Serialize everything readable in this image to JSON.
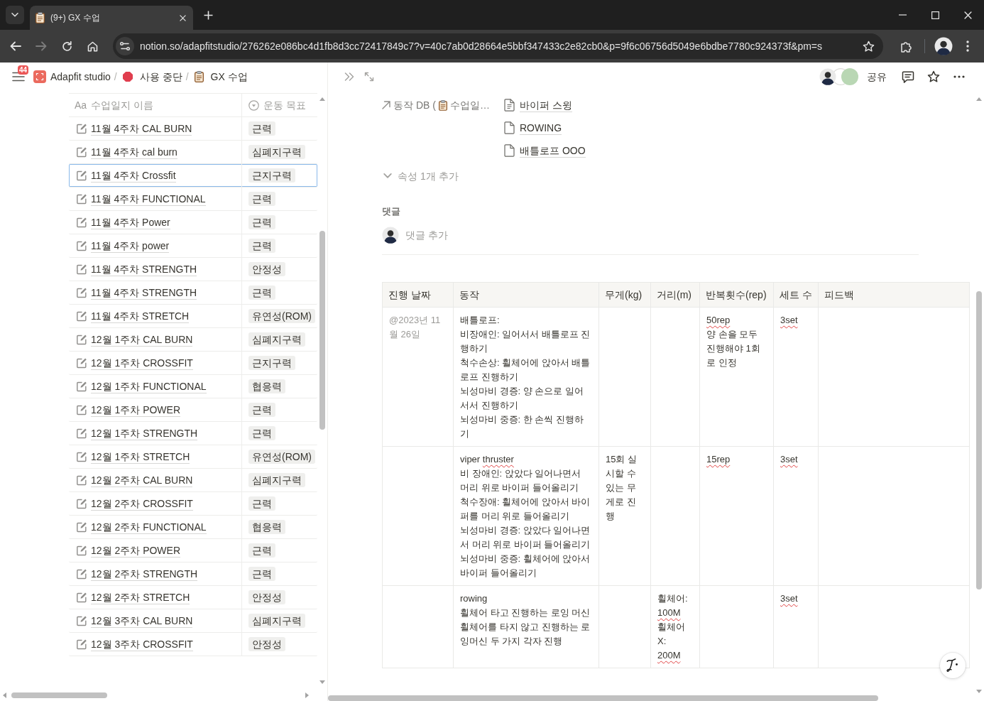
{
  "browser": {
    "tab": {
      "title": "(9+) GX 수업"
    },
    "nav_buttons": [
      {
        "kind": "back",
        "disabled": false
      },
      {
        "kind": "forward",
        "disabled": true
      },
      {
        "kind": "reload",
        "disabled": false
      },
      {
        "kind": "home",
        "disabled": false
      }
    ],
    "url": "notion.so/adapfitstudio/276262e086bc4d1fb8d3cc72417849c7?v=40c7ab0d28664e5bbf347433c2e82cb0&p=9f6c06756d5049e6bdbe7780c924373f&pm=s"
  },
  "breadcrumb": {
    "notification_count": "44",
    "items": [
      {
        "kind": "workspace",
        "label": "Adapfit studio",
        "separator": "/"
      },
      {
        "kind": "stop",
        "label": "사용 중단",
        "separator": "/"
      },
      {
        "kind": "clipboard",
        "label": "GX 수업"
      }
    ]
  },
  "list_table": {
    "columns": [
      {
        "kind": "title",
        "type_glyph": "Aa",
        "label": "수업일지 이름"
      },
      {
        "kind": "select",
        "label": "운동 목표"
      }
    ],
    "rows": [
      {
        "name": "11월 4주차 CAL BURN",
        "goal": "근력",
        "selected": false
      },
      {
        "name": "11월 4주차 cal burn",
        "goal": "심폐지구력",
        "selected": false
      },
      {
        "name": "11월 4주차 Crossfit",
        "goal": "근지구력",
        "selected": true
      },
      {
        "name": "11월 4주차 FUNCTIONAL",
        "goal": "근력",
        "selected": false
      },
      {
        "name": "11월 4주차 Power",
        "goal": "근력",
        "selected": false
      },
      {
        "name": "11월 4주차 power",
        "goal": "근력",
        "selected": false
      },
      {
        "name": "11월 4주차 STRENGTH",
        "goal": "안정성",
        "selected": false
      },
      {
        "name": "11월 4주차 STRENGTH",
        "goal": "근력",
        "selected": false
      },
      {
        "name": "11월 4주차 STRETCH",
        "goal": "유연성(ROM)",
        "selected": false
      },
      {
        "name": "12월 1주차 CAL BURN",
        "goal": "심폐지구력",
        "selected": false
      },
      {
        "name": "12월 1주차 CROSSFIT",
        "goal": "근지구력",
        "selected": false
      },
      {
        "name": "12월 1주차 FUNCTIONAL",
        "goal": "협응력",
        "selected": false
      },
      {
        "name": "12월 1주차 POWER",
        "goal": "근력",
        "selected": false
      },
      {
        "name": "12월 1주차 STRENGTH",
        "goal": "근력",
        "selected": false
      },
      {
        "name": "12월 1주차 STRETCH",
        "goal": "유연성(ROM)",
        "selected": false
      },
      {
        "name": "12월 2주차 CAL BURN",
        "goal": "심폐지구력",
        "selected": false
      },
      {
        "name": "12월 2주차 CROSSFIT",
        "goal": "근력",
        "selected": false
      },
      {
        "name": "12월 2주차 FUNCTIONAL",
        "goal": "협응력",
        "selected": false
      },
      {
        "name": "12월 2주차 POWER",
        "goal": "근력",
        "selected": false
      },
      {
        "name": "12월 2주차 STRENGTH",
        "goal": "근력",
        "selected": false
      },
      {
        "name": "12월 2주차 STRETCH",
        "goal": "안정성",
        "selected": false
      },
      {
        "name": "12월 3주차 CAL BURN",
        "goal": "심폐지구력",
        "selected": false
      },
      {
        "name": "12월 3주차 CROSSFIT",
        "goal": "안정성",
        "selected": false
      }
    ]
  },
  "topbar": {
    "avatars": [
      {
        "kind": "photo"
      },
      {
        "kind": "plain"
      },
      {
        "kind": "plain",
        "color": "#b9d7b4"
      }
    ],
    "share": "공유"
  },
  "properties": [
    {
      "name": "동작 DB (",
      "name_rest": "수업일…",
      "values": [
        {
          "kind": "doc",
          "title": "바이퍼 스윙"
        },
        {
          "kind": "blank",
          "title": "ROWING"
        },
        {
          "kind": "blank",
          "title": "배틀로프 OOO"
        }
      ]
    }
  ],
  "more_properties": {
    "label": "속성 1개 추가"
  },
  "comments": {
    "heading": "댓글",
    "placeholder": "댓글 추가"
  },
  "detail_table": {
    "columns": [
      {
        "label": "진행 날짜",
        "kind": "date"
      },
      {
        "label": "동작",
        "kind": "text"
      },
      {
        "label": "무게(kg)",
        "kind": "text"
      },
      {
        "label": "거리(m)",
        "kind": "text"
      },
      {
        "label": "반복횟수(rep)",
        "kind": "text"
      },
      {
        "label": "세트 수",
        "kind": "text"
      },
      {
        "label": "피드백",
        "kind": "text"
      }
    ],
    "rows": [
      {
        "cells": [
          {
            "lines": [
              [
                {
                  "text": "@2023년 11월 26일",
                  "misspelled": false
                }
              ]
            ]
          },
          {
            "lines": [
              [
                {
                  "text": "배틀로프:",
                  "misspelled": false
                }
              ],
              [
                {
                  "text": "비장애인: 일어서서 배틀로프 진행하기",
                  "misspelled": false
                }
              ],
              [
                {
                  "text": "척수손상: 휠체어에 앉아서 배틀로프 진행하기",
                  "misspelled": false
                }
              ],
              [
                {
                  "text": "뇌성마비 경증: 양 손으로 일어서서 진행하기",
                  "misspelled": false
                }
              ],
              [
                {
                  "text": "뇌성마비 중증: 한 손씩 진행하기",
                  "misspelled": false
                }
              ]
            ]
          },
          null,
          null,
          {
            "lines": [
              [
                {
                  "text": "50rep",
                  "misspelled": true
                }
              ],
              [
                {
                  "text": "양 손을 모두 진행해야 1회로 인정",
                  "misspelled": false
                }
              ]
            ]
          },
          {
            "lines": [
              [
                {
                  "text": "3set",
                  "misspelled": true
                }
              ]
            ]
          },
          null
        ]
      },
      {
        "cells": [
          null,
          {
            "lines": [
              [
                {
                  "text": "viper",
                  "misspelled": false
                },
                {
                  "text": "thruster",
                  "misspelled": true
                }
              ],
              [
                {
                  "text": "비 장애인: 앉았다 일어나면서 머리 위로 바이퍼 들어올리기",
                  "misspelled": false
                }
              ],
              [
                {
                  "text": "척수장애: 휠체어에 앉아서 바이퍼를 머리 위로 들어올리기",
                  "misspelled": false
                }
              ],
              [
                {
                  "text": "뇌성마비 경증: 앉았다 일어나면서 머리 위로 바이퍼 들어올리기",
                  "misspelled": false
                }
              ],
              [
                {
                  "text": "뇌성마비 중증: 휠체어에 앉아서 바이퍼 들어올리기",
                  "misspelled": false
                }
              ]
            ]
          },
          {
            "lines": [
              [
                {
                  "text": "15회 실시할 수 있는 무게로 진행",
                  "misspelled": false
                }
              ]
            ]
          },
          null,
          {
            "lines": [
              [
                {
                  "text": "15rep",
                  "misspelled": true
                }
              ]
            ]
          },
          {
            "lines": [
              [
                {
                  "text": "3set",
                  "misspelled": true
                }
              ]
            ]
          },
          null
        ]
      },
      {
        "cells": [
          null,
          {
            "lines": [
              [
                {
                  "text": "rowing",
                  "misspelled": false
                }
              ],
              [
                {
                  "text": "휠체어 타고 진행하는 로잉 머신",
                  "misspelled": false
                }
              ],
              [
                {
                  "text": "휠체어를 타지 않고 진행하는 로잉머신 두 가지 각자 진행",
                  "misspelled": false
                }
              ]
            ]
          },
          null,
          {
            "lines": [
              [
                {
                  "text": "휠체어:",
                  "misspelled": false
                }
              ],
              [
                {
                  "text": "100M",
                  "misspelled": true
                }
              ],
              [
                {
                  "text": "휠체어 X:",
                  "misspelled": false
                }
              ],
              [
                {
                  "text": "200M",
                  "misspelled": true
                }
              ]
            ]
          },
          null,
          {
            "lines": [
              [
                {
                  "text": "3set",
                  "misspelled": true
                }
              ]
            ]
          },
          null
        ]
      }
    ]
  }
}
